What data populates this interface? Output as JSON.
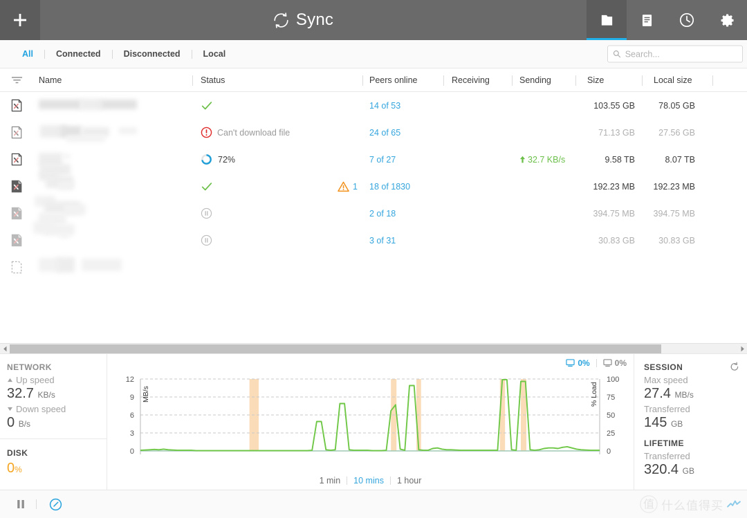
{
  "header": {
    "title": "Sync",
    "add_label": "+",
    "sync_icon": "sync-circle-icon",
    "tabs": [
      {
        "name": "folders",
        "icon": "folder-icon",
        "active": true
      },
      {
        "name": "devices",
        "icon": "document-icon",
        "active": false
      },
      {
        "name": "history",
        "icon": "clock-icon",
        "active": false
      },
      {
        "name": "settings",
        "icon": "gear-icon",
        "active": false
      }
    ]
  },
  "filterbar": {
    "tabs": [
      {
        "label": "All",
        "active": true
      },
      {
        "label": "Connected",
        "active": false
      },
      {
        "label": "Disconnected",
        "active": false
      },
      {
        "label": "Local",
        "active": false
      }
    ],
    "search": {
      "placeholder": "Search...",
      "value": "",
      "icon": "search-icon"
    }
  },
  "table": {
    "filter_icon": "filter-icon",
    "columns": [
      "Name",
      "Status",
      "Peers online",
      "Receiving",
      "Sending",
      "Size",
      "Local size"
    ],
    "rows": [
      {
        "icon": "folder-x-icon",
        "icon_style": "outline",
        "dim": false,
        "status_icon": "check-icon",
        "status_text": "",
        "warning": "",
        "peers": "14 of 53",
        "receiving": "",
        "sending": "",
        "size": "103.55 GB",
        "local_size": "78.05 GB"
      },
      {
        "icon": "folder-x-icon",
        "icon_style": "outline",
        "dim": true,
        "status_icon": "error-icon",
        "status_text": "Can't download file",
        "warning": "",
        "peers": "24 of 65",
        "receiving": "",
        "sending": "",
        "size": "71.13 GB",
        "local_size": "27.56 GB"
      },
      {
        "icon": "folder-x-icon",
        "icon_style": "outline",
        "dim": false,
        "status_icon": "progress-ring-icon",
        "status_text": "72%",
        "warning": "",
        "peers": "7 of 27",
        "receiving": "",
        "sending": "32.7 KB/s",
        "size": "9.58 TB",
        "local_size": "8.07 TB"
      },
      {
        "icon": "folder-x-icon",
        "icon_style": "filled",
        "dim": false,
        "status_icon": "check-icon",
        "status_text": "",
        "warning": "1",
        "peers": "18 of 1830",
        "receiving": "",
        "sending": "",
        "size": "192.23 MB",
        "local_size": "192.23 MB"
      },
      {
        "icon": "folder-x-icon",
        "icon_style": "half",
        "dim": true,
        "status_icon": "pause-icon",
        "status_text": "",
        "warning": "",
        "peers": "2 of 18",
        "receiving": "",
        "sending": "",
        "size": "394.75 MB",
        "local_size": "394.75 MB"
      },
      {
        "icon": "folder-x-icon",
        "icon_style": "half",
        "dim": true,
        "status_icon": "pause-icon",
        "status_text": "",
        "warning": "",
        "peers": "3 of 31",
        "receiving": "",
        "sending": "",
        "size": "30.83 GB",
        "local_size": "30.83 GB"
      },
      {
        "icon": "folder-dashed-icon",
        "icon_style": "dashed",
        "dim": true,
        "status_icon": "",
        "status_text": "",
        "warning": "",
        "peers": "",
        "receiving": "",
        "sending": "",
        "size": "",
        "local_size": ""
      }
    ]
  },
  "network": {
    "title": "NETWORK",
    "up_label": "Up speed",
    "up_value": "32.7",
    "up_unit": "KB/s",
    "down_label": "Down speed",
    "down_value": "0",
    "down_unit": "B/s"
  },
  "disk": {
    "title": "DISK",
    "value": "0",
    "unit": "%",
    "color": "#f5a623"
  },
  "session": {
    "title": "SESSION",
    "max_speed_label": "Max speed",
    "max_speed_value": "27.4",
    "max_speed_unit": "MB/s",
    "transferred_label": "Transferred",
    "transferred_value": "145",
    "transferred_unit": "GB",
    "reset_icon": "reset-icon"
  },
  "lifetime": {
    "title": "LIFETIME",
    "transferred_label": "Transferred",
    "transferred_value": "320.4",
    "transferred_unit": "GB"
  },
  "load_indicators": [
    {
      "icon": "monitor-icon",
      "label": "0%",
      "color": "#29a3dd"
    },
    {
      "icon": "monitor-icon",
      "label": "0%",
      "color": "#8d8d8d"
    }
  ],
  "ranges": [
    {
      "label": "1 min",
      "active": false
    },
    {
      "label": "10 mins",
      "active": true
    },
    {
      "label": "1 hour",
      "active": false
    }
  ],
  "bottombar": {
    "pause_icon": "pause-icon",
    "speed_icon": "speedometer-icon",
    "watermark": "什么值得买"
  },
  "chart_data": {
    "type": "line",
    "title": "",
    "xlabel": "",
    "ylabel": "MB/s",
    "y2label": "% Load",
    "ylim": [
      0,
      12
    ],
    "y2lim": [
      0,
      100
    ],
    "yticks": [
      0,
      3,
      6,
      9,
      12
    ],
    "y2ticks": [
      0,
      25,
      50,
      75,
      100
    ],
    "grid": true,
    "legend": "none",
    "line_color": "#6fc746",
    "band_color": "#fbdcb9",
    "series": [
      {
        "name": "Speed (MB/s)",
        "x": [
          0,
          1,
          2,
          3,
          4,
          5,
          6,
          7,
          8,
          9,
          10,
          11,
          12,
          13,
          14,
          15,
          16,
          17,
          18,
          19,
          20,
          21,
          22,
          23,
          24,
          25,
          26,
          27,
          28,
          29,
          30,
          31,
          32,
          33,
          34,
          35,
          36,
          37,
          38,
          39,
          40,
          41,
          42,
          43,
          44,
          45,
          46,
          47,
          48,
          49,
          50,
          51,
          52,
          53,
          54,
          55,
          56,
          57,
          58,
          59,
          60,
          61,
          62,
          63,
          64,
          65,
          66,
          67,
          68,
          69,
          70,
          71,
          72,
          73,
          74,
          75,
          76,
          77,
          78,
          79,
          80,
          81,
          82,
          83,
          84,
          85,
          86,
          87,
          88,
          89,
          90,
          91,
          92,
          93,
          94,
          95,
          96,
          97,
          98,
          99
        ],
        "values": [
          0.1,
          0.15,
          0.2,
          0.25,
          0.2,
          0.3,
          0.2,
          0.15,
          0.1,
          0.1,
          0.1,
          0.1,
          0.05,
          0.05,
          0.05,
          0.05,
          0.05,
          0.05,
          0.05,
          0.05,
          0.05,
          0.05,
          0.05,
          0.05,
          0.05,
          0.05,
          0.05,
          0.05,
          0.05,
          0.05,
          0.05,
          0.05,
          0.05,
          0.05,
          0.05,
          0.05,
          0.05,
          0.1,
          4.9,
          4.9,
          0.2,
          0.1,
          0.2,
          7.9,
          7.9,
          0.2,
          0.1,
          0.1,
          0.1,
          0.1,
          0.05,
          0.05,
          0.05,
          0.1,
          6.7,
          7.7,
          0.3,
          0.1,
          10.9,
          10.9,
          0.2,
          0.1,
          0.1,
          0.4,
          0.5,
          0.3,
          0.2,
          0.2,
          0.15,
          0.1,
          0.1,
          0.1,
          0.1,
          0.1,
          0.1,
          0.1,
          0.1,
          0.1,
          11.9,
          11.9,
          0.2,
          0.1,
          11.6,
          11.6,
          0.2,
          0.1,
          0.2,
          0.4,
          0.5,
          0.5,
          0.4,
          0.6,
          0.7,
          0.5,
          0.3,
          0.2,
          0.15,
          0.1,
          0.1,
          0.1
        ]
      }
    ],
    "disk_bands": [
      {
        "x_start": 23.5,
        "x_end": 25.5
      },
      {
        "x_start": 54.0,
        "x_end": 55.2
      },
      {
        "x_start": 59.5,
        "x_end": 60.5
      },
      {
        "x_start": 77.5,
        "x_end": 78.6
      },
      {
        "x_start": 82.0,
        "x_end": 83.2
      }
    ]
  }
}
